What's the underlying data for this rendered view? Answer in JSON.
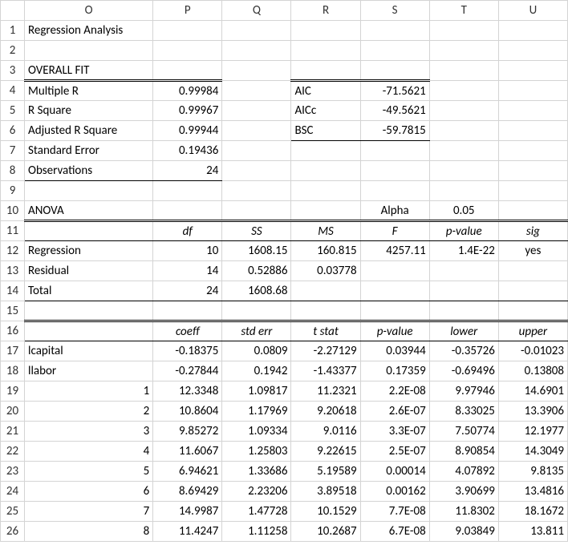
{
  "cols": [
    "O",
    "P",
    "Q",
    "R",
    "S",
    "T",
    "U"
  ],
  "title": "Regression Analysis",
  "overall_fit": {
    "heading": "OVERALL FIT",
    "rows": [
      {
        "label": "Multiple R",
        "val": "0.99984",
        "k2": "AIC",
        "v2": "-71.5621"
      },
      {
        "label": "R Square",
        "val": "0.99967",
        "k2": "AICc",
        "v2": "-49.5621"
      },
      {
        "label": "Adjusted R Square",
        "val": "0.99944",
        "k2": "BSC",
        "v2": "-59.7815"
      },
      {
        "label": "Standard Error",
        "val": "0.19436",
        "k2": "",
        "v2": ""
      },
      {
        "label": "Observations",
        "val": "24",
        "k2": "",
        "v2": ""
      }
    ]
  },
  "anova": {
    "heading": "ANOVA",
    "alpha_label": "Alpha",
    "alpha_val": "0.05",
    "headers": {
      "df": "df",
      "ss": "SS",
      "ms": "MS",
      "f": "F",
      "p": "p-value",
      "sig": "sig"
    },
    "rows": [
      {
        "label": "Regression",
        "df": "10",
        "ss": "1608.15",
        "ms": "160.815",
        "f": "4257.11",
        "p": "1.4E-22",
        "sig": "yes"
      },
      {
        "label": "Residual",
        "df": "14",
        "ss": "0.52886",
        "ms": "0.03778",
        "f": "",
        "p": "",
        "sig": ""
      },
      {
        "label": "Total",
        "df": "24",
        "ss": "1608.68",
        "ms": "",
        "f": "",
        "p": "",
        "sig": ""
      }
    ]
  },
  "coef": {
    "headers": {
      "coeff": "coeff",
      "se": "std err",
      "t": "t stat",
      "p": "p-value",
      "lo": "lower",
      "hi": "upper"
    },
    "rows": [
      {
        "label": "lcapital",
        "coeff": "-0.18375",
        "se": "0.0809",
        "t": "-2.27129",
        "p": "0.03944",
        "lo": "-0.35726",
        "hi": "-0.01023"
      },
      {
        "label": "llabor",
        "coeff": "-0.27844",
        "se": "0.1942",
        "t": "-1.43377",
        "p": "0.17359",
        "lo": "-0.69496",
        "hi": "0.13808"
      },
      {
        "label": "1",
        "coeff": "12.3348",
        "se": "1.09817",
        "t": "11.2321",
        "p": "2.2E-08",
        "lo": "9.97946",
        "hi": "14.6901"
      },
      {
        "label": "2",
        "coeff": "10.8604",
        "se": "1.17969",
        "t": "9.20618",
        "p": "2.6E-07",
        "lo": "8.33025",
        "hi": "13.3906"
      },
      {
        "label": "3",
        "coeff": "9.85272",
        "se": "1.09334",
        "t": "9.0116",
        "p": "3.3E-07",
        "lo": "7.50774",
        "hi": "12.1977"
      },
      {
        "label": "4",
        "coeff": "11.6067",
        "se": "1.25803",
        "t": "9.22615",
        "p": "2.5E-07",
        "lo": "8.90854",
        "hi": "14.3049"
      },
      {
        "label": "5",
        "coeff": "6.94621",
        "se": "1.33686",
        "t": "5.19589",
        "p": "0.00014",
        "lo": "4.07892",
        "hi": "9.8135"
      },
      {
        "label": "6",
        "coeff": "8.69429",
        "se": "2.23206",
        "t": "3.89518",
        "p": "0.00162",
        "lo": "3.90699",
        "hi": "13.4816"
      },
      {
        "label": "7",
        "coeff": "14.9987",
        "se": "1.47728",
        "t": "10.1529",
        "p": "7.7E-08",
        "lo": "11.8302",
        "hi": "18.1672"
      },
      {
        "label": "8",
        "coeff": "11.4247",
        "se": "1.11258",
        "t": "10.2687",
        "p": "6.7E-08",
        "lo": "9.03849",
        "hi": "13.811"
      }
    ]
  }
}
